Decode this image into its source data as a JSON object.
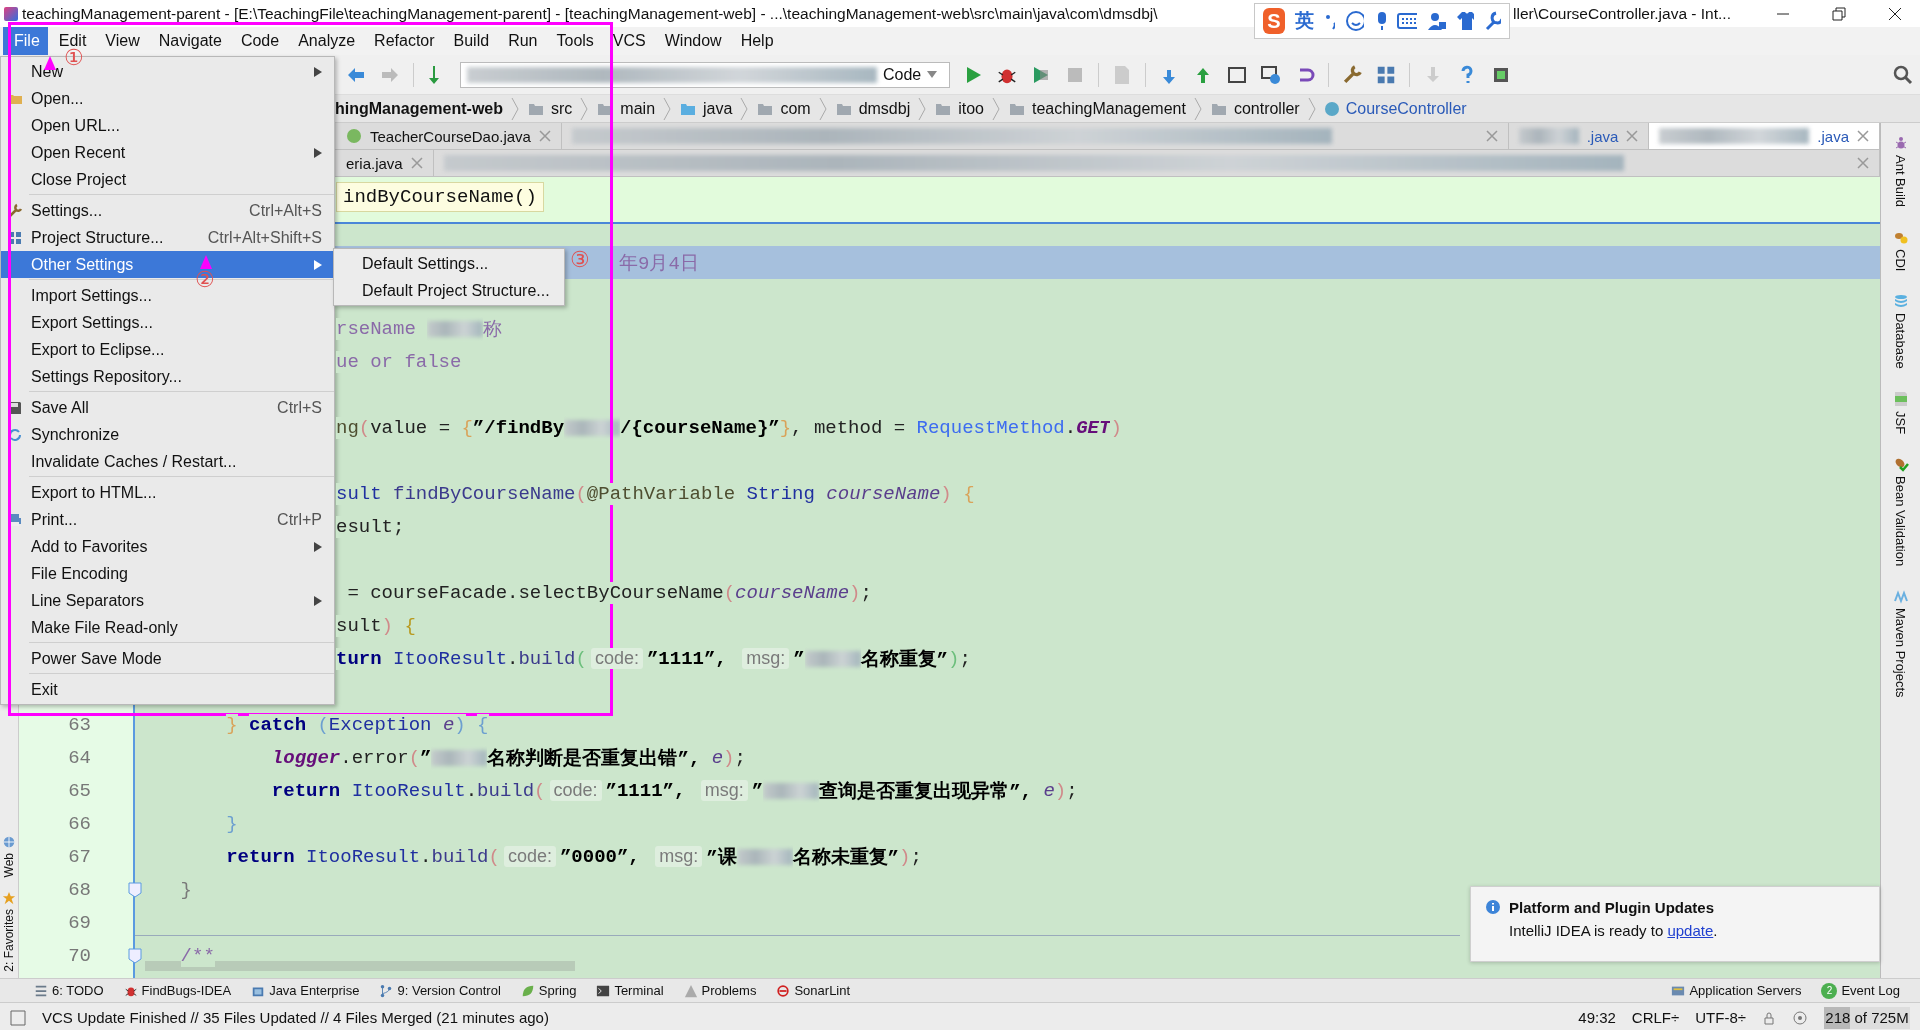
{
  "window": {
    "title": "teachingManagement-parent - [E:\\TeachingFile\\teachingManagement-parent] - [teachingManagement-web] - ...\\teachingManagement-web\\src\\main\\java\\com\\dmsdbj\\",
    "title_end": "ller\\CourseController.java - Int..."
  },
  "ime_toolbar": {
    "logo": "S",
    "mode": "英"
  },
  "menu_bar": [
    {
      "label": "File",
      "selected": true
    },
    {
      "label": "Edit",
      "selected": false
    },
    {
      "label": "View",
      "selected": false
    },
    {
      "label": "Navigate",
      "selected": false
    },
    {
      "label": "Code",
      "selected": false
    },
    {
      "label": "Analyze",
      "selected": false
    },
    {
      "label": "Refactor",
      "selected": false
    },
    {
      "label": "Build",
      "selected": false
    },
    {
      "label": "Run",
      "selected": false
    },
    {
      "label": "Tools",
      "selected": false
    },
    {
      "label": "VCS",
      "selected": false
    },
    {
      "label": "Window",
      "selected": false
    },
    {
      "label": "Help",
      "selected": false
    }
  ],
  "toolbar": {
    "run_config": "Code"
  },
  "breadcrumbs": [
    {
      "label": "hingManagement-web",
      "kind": "module"
    },
    {
      "label": "src",
      "kind": "folder"
    },
    {
      "label": "main",
      "kind": "folder"
    },
    {
      "label": "java",
      "kind": "source"
    },
    {
      "label": "com",
      "kind": "package"
    },
    {
      "label": "dmsdbj",
      "kind": "package"
    },
    {
      "label": "itoo",
      "kind": "package"
    },
    {
      "label": "teachingManagement",
      "kind": "package"
    },
    {
      "label": "controller",
      "kind": "package"
    },
    {
      "label": "CourseController",
      "kind": "class"
    }
  ],
  "tabs_row_1": [
    {
      "label": "TeacherCourseDao.java",
      "kind": "interface",
      "selected": false
    },
    {
      "kind": "blurred",
      "selected": false
    },
    {
      "label": ".java",
      "kind": "partly_blurred",
      "selected": false
    },
    {
      "label": ".java",
      "kind": "partly_blurred",
      "selected": true
    }
  ],
  "tabs_row_2": [
    {
      "label": "eria.java",
      "kind": "plain",
      "selected": false
    },
    {
      "kind": "blurred",
      "selected": false
    }
  ],
  "file_menu": [
    {
      "label": "New",
      "submenu": true,
      "kind": "plain",
      "selected": false
    },
    {
      "label": "Open...",
      "kind": "folder",
      "selected": false
    },
    {
      "label": "Open URL...",
      "kind": "plain",
      "selected": false
    },
    {
      "label": "Open Recent",
      "submenu": true,
      "kind": "plain",
      "selected": false
    },
    {
      "label": "Close Project",
      "kind": "plain",
      "selected": false
    },
    {
      "kind": "separator"
    },
    {
      "label": "Settings...",
      "shortcut": "Ctrl+Alt+S",
      "kind": "wrench",
      "selected": false
    },
    {
      "label": "Project Structure...",
      "shortcut": "Ctrl+Alt+Shift+S",
      "kind": "grid",
      "selected": false
    },
    {
      "label": "Other Settings",
      "submenu": true,
      "kind": "plain",
      "selected": true
    },
    {
      "kind": "separator"
    },
    {
      "label": "Import Settings...",
      "kind": "plain",
      "selected": false
    },
    {
      "label": "Export Settings...",
      "kind": "plain",
      "selected": false
    },
    {
      "label": "Export to Eclipse...",
      "kind": "plain",
      "selected": false
    },
    {
      "label": "Settings Repository...",
      "kind": "plain",
      "selected": false
    },
    {
      "kind": "separator"
    },
    {
      "label": "Save All",
      "shortcut": "Ctrl+S",
      "kind": "disk",
      "selected": false
    },
    {
      "label": "Synchronize",
      "kind": "sync",
      "selected": false
    },
    {
      "label": "Invalidate Caches / Restart...",
      "kind": "plain",
      "selected": false
    },
    {
      "kind": "separator"
    },
    {
      "label": "Export to HTML...",
      "kind": "plain",
      "selected": false
    },
    {
      "label": "Print...",
      "shortcut": "Ctrl+P",
      "kind": "printer",
      "selected": false
    },
    {
      "label": "Add to Favorites",
      "submenu": true,
      "kind": "plain",
      "selected": false
    },
    {
      "label": "File Encoding",
      "kind": "plain",
      "selected": false
    },
    {
      "label": "Line Separators",
      "submenu": true,
      "kind": "plain",
      "selected": false
    },
    {
      "label": "Make File Read-only",
      "kind": "plain",
      "selected": false
    },
    {
      "kind": "separator"
    },
    {
      "label": "Power Save Mode",
      "kind": "plain",
      "selected": false
    },
    {
      "kind": "separator"
    },
    {
      "label": "Exit",
      "kind": "plain",
      "selected": false
    }
  ],
  "submenu": [
    {
      "label": "Default Settings...",
      "selected": false
    },
    {
      "label": "Default Project Structure...",
      "selected": false
    }
  ],
  "annotations": [
    "①",
    "②",
    "③"
  ],
  "editor": {
    "tooltip": "indByCourseName()",
    "lines": [
      {
        "kind": "blank"
      },
      {
        "kind": "blank"
      },
      {
        "kind": "behind_submenu",
        "caret_line": true,
        "tokens": [
          {
            "text": "年9月4日",
            "kind": "comment"
          }
        ]
      },
      {
        "kind": "blank"
      },
      {
        "kind": "partial",
        "tokens": [
          {
            "text": "rseName ",
            "kind": "comment"
          },
          {
            "kind": "blur"
          },
          {
            "text": "称",
            "kind": "comment"
          }
        ]
      },
      {
        "kind": "partial",
        "tokens": [
          {
            "text": "ue or false",
            "kind": "comment"
          }
        ]
      },
      {
        "kind": "blank"
      },
      {
        "kind": "partial",
        "tokens": [
          {
            "text": "ng",
            "kind": "annot"
          },
          {
            "text": "(",
            "kind": "bracket",
            "color": "#d08a8a"
          },
          {
            "text": "value = ",
            "kind": "plain"
          },
          {
            "text": "{",
            "kind": "bracket",
            "color": "#d9a35a"
          },
          {
            "text": "”/findBy",
            "kind": "str"
          },
          {
            "kind": "blur"
          },
          {
            "text": "/{courseName}”",
            "kind": "str"
          },
          {
            "text": "}",
            "kind": "bracket",
            "color": "#d9a35a"
          },
          {
            "text": ", method = ",
            "kind": "plain"
          },
          {
            "text": "RequestMethod",
            "kind": "enum"
          },
          {
            "text": ".",
            "kind": "plain"
          },
          {
            "text": "GET",
            "kind": "const"
          },
          {
            "text": ")",
            "kind": "bracket",
            "color": "#d08a8a"
          }
        ]
      },
      {
        "kind": "blank"
      },
      {
        "kind": "partial",
        "tokens": [
          {
            "text": "sult",
            "kind": "type"
          },
          {
            "text": " findByCourseName",
            "kind": "method"
          },
          {
            "text": "(",
            "kind": "bracket",
            "color": "#d08a8a"
          },
          {
            "text": "@PathVariable ",
            "kind": "annot"
          },
          {
            "text": "String ",
            "kind": "type"
          },
          {
            "text": "courseName",
            "kind": "param"
          },
          {
            "text": ")",
            "kind": "bracket",
            "color": "#d08a8a"
          },
          {
            "text": " {",
            "kind": "bracket",
            "color": "#d9a35a"
          }
        ]
      },
      {
        "kind": "partial",
        "tokens": [
          {
            "text": "esult;",
            "kind": "plain"
          }
        ]
      },
      {
        "kind": "blank"
      },
      {
        "kind": "partial",
        "tokens": [
          {
            "text": " = courseFacade.selectByCourseName",
            "kind": "plain"
          },
          {
            "text": "(",
            "kind": "bracket",
            "color": "#d08a8a"
          },
          {
            "text": "courseName",
            "kind": "param"
          },
          {
            "text": ")",
            "kind": "bracket",
            "color": "#d08a8a"
          },
          {
            "text": ";",
            "kind": "plain"
          }
        ]
      },
      {
        "kind": "partial",
        "tokens": [
          {
            "text": "sult",
            "kind": "plain"
          },
          {
            "text": ")",
            "kind": "bracket",
            "color": "#d08a8a"
          },
          {
            "text": " {",
            "kind": "bracket",
            "color": "#b89a20"
          }
        ]
      },
      {
        "kind": "partial",
        "tokens": [
          {
            "text": "turn ",
            "kind": "kw"
          },
          {
            "text": "ItooResult",
            "kind": "type"
          },
          {
            "text": ".",
            "kind": "plain"
          },
          {
            "text": "build",
            "kind": "method"
          },
          {
            "text": "(",
            "kind": "bracket",
            "color": "#6cbf7c"
          },
          {
            "text": "code:",
            "kind": "hint"
          },
          {
            "text": "”1111”, ",
            "kind": "str"
          },
          {
            "text": "msg:",
            "kind": "hint"
          },
          {
            "text": "”",
            "kind": "str"
          },
          {
            "kind": "blur"
          },
          {
            "text": "名称重复”",
            "kind": "str"
          },
          {
            "text": ")",
            "kind": "bracket",
            "color": "#6cbf7c"
          },
          {
            "text": ";",
            "kind": "plain"
          }
        ]
      },
      {
        "kind": "blank"
      },
      {
        "kind": "code",
        "number": "63",
        "tokens": [
          {
            "text": "        }",
            "kind": "bracket",
            "color": "#d9a35a"
          },
          {
            "text": " catch ",
            "kind": "kw"
          },
          {
            "text": "(",
            "kind": "bracket",
            "color": "#6c9fd0"
          },
          {
            "text": "Exception ",
            "kind": "type"
          },
          {
            "text": "e",
            "kind": "param"
          },
          {
            "text": ")",
            "kind": "bracket",
            "color": "#6c9fd0"
          },
          {
            "text": " {",
            "kind": "bracket",
            "color": "#6c9fd0"
          }
        ]
      },
      {
        "kind": "code",
        "number": "64",
        "tokens": [
          {
            "text": "            logger",
            "kind": "field"
          },
          {
            "text": ".error",
            "kind": "plain"
          },
          {
            "text": "(",
            "kind": "bracket",
            "color": "#d08a8a"
          },
          {
            "text": "”",
            "kind": "str"
          },
          {
            "kind": "blur"
          },
          {
            "text": "名称判断是否重复出错”, ",
            "kind": "str"
          },
          {
            "text": "e",
            "kind": "param"
          },
          {
            "text": ")",
            "kind": "bracket",
            "color": "#d08a8a"
          },
          {
            "text": ";",
            "kind": "plain"
          }
        ]
      },
      {
        "kind": "code",
        "number": "65",
        "tokens": [
          {
            "text": "            return ",
            "kind": "kw"
          },
          {
            "text": "ItooResult",
            "kind": "type"
          },
          {
            "text": ".",
            "kind": "plain"
          },
          {
            "text": "build",
            "kind": "method"
          },
          {
            "text": "(",
            "kind": "bracket",
            "color": "#d08a8a"
          },
          {
            "text": "code:",
            "kind": "hint"
          },
          {
            "text": "”1111”, ",
            "kind": "str"
          },
          {
            "text": "msg:",
            "kind": "hint"
          },
          {
            "text": "”",
            "kind": "str"
          },
          {
            "kind": "blur"
          },
          {
            "text": "查询是否重复出现异常”, ",
            "kind": "str"
          },
          {
            "text": "e",
            "kind": "param"
          },
          {
            "text": ")",
            "kind": "bracket",
            "color": "#d08a8a"
          },
          {
            "text": ";",
            "kind": "plain"
          }
        ]
      },
      {
        "kind": "code",
        "number": "66",
        "tokens": [
          {
            "text": "        }",
            "kind": "bracket",
            "color": "#6c9fd0"
          }
        ]
      },
      {
        "kind": "code",
        "number": "67",
        "tokens": [
          {
            "text": "        return ",
            "kind": "kw"
          },
          {
            "text": "ItooResult",
            "kind": "type"
          },
          {
            "text": ".",
            "kind": "plain"
          },
          {
            "text": "build",
            "kind": "method"
          },
          {
            "text": "(",
            "kind": "bracket",
            "color": "#d08a8a"
          },
          {
            "text": "code:",
            "kind": "hint"
          },
          {
            "text": "”0000”, ",
            "kind": "str"
          },
          {
            "text": "msg:",
            "kind": "hint"
          },
          {
            "text": "”课",
            "kind": "str"
          },
          {
            "kind": "blur"
          },
          {
            "text": "名称未重复”",
            "kind": "str"
          },
          {
            "text": ")",
            "kind": "bracket",
            "color": "#d08a8a"
          },
          {
            "text": ";",
            "kind": "plain"
          }
        ]
      },
      {
        "kind": "code",
        "number": "68",
        "fold": true,
        "tokens": [
          {
            "text": "    }",
            "kind": "bracket",
            "color": "#7a7a7a"
          }
        ]
      },
      {
        "kind": "code",
        "number": "69"
      },
      {
        "kind": "code",
        "number": "70",
        "fold": true,
        "tokens": [
          {
            "text": "    /**",
            "kind": "comment"
          }
        ]
      }
    ]
  },
  "left_tool_windows": [
    {
      "label": "Web",
      "kind": "globe"
    },
    {
      "label": "2: Favorites",
      "kind": "star"
    }
  ],
  "right_tool_windows": [
    {
      "label": "Ant Build",
      "kind": "ant"
    },
    {
      "label": "CDI",
      "kind": "beans"
    },
    {
      "label": "Database",
      "kind": "cylinder"
    },
    {
      "label": "JSF",
      "kind": "sheet"
    },
    {
      "label": "Bean Validation",
      "kind": "check"
    },
    {
      "label": "Maven Projects",
      "kind": "zigzag"
    }
  ],
  "tool_window_bar": {
    "left": [
      {
        "label": "6: TODO",
        "kind": "list"
      },
      {
        "label": "FindBugs-IDEA",
        "kind": "bug"
      },
      {
        "label": "Java Enterprise",
        "kind": "cube"
      },
      {
        "label": "9: Version Control",
        "kind": "branch"
      },
      {
        "label": "Spring",
        "kind": "leaf"
      },
      {
        "label": "Terminal",
        "kind": "terminal"
      },
      {
        "label": "Problems",
        "kind": "warning"
      },
      {
        "label": "SonarLint",
        "kind": "ring"
      }
    ],
    "right": [
      {
        "label": "Application Servers",
        "kind": "server"
      },
      {
        "label": "Event Log",
        "badge": "2"
      }
    ]
  },
  "notification": {
    "title": "Platform and Plugin Updates",
    "text": "IntelliJ IDEA is ready to ",
    "link": "update",
    "end": "."
  },
  "status_bar": {
    "message": "VCS Update Finished // 35 Files Updated // 4 Files Merged (21 minutes ago)",
    "position": "49:32",
    "line_separator": "CRLF÷",
    "encoding": "UTF-8÷",
    "memory": {
      "text": "218 of 725M",
      "level": 0.3
    }
  }
}
